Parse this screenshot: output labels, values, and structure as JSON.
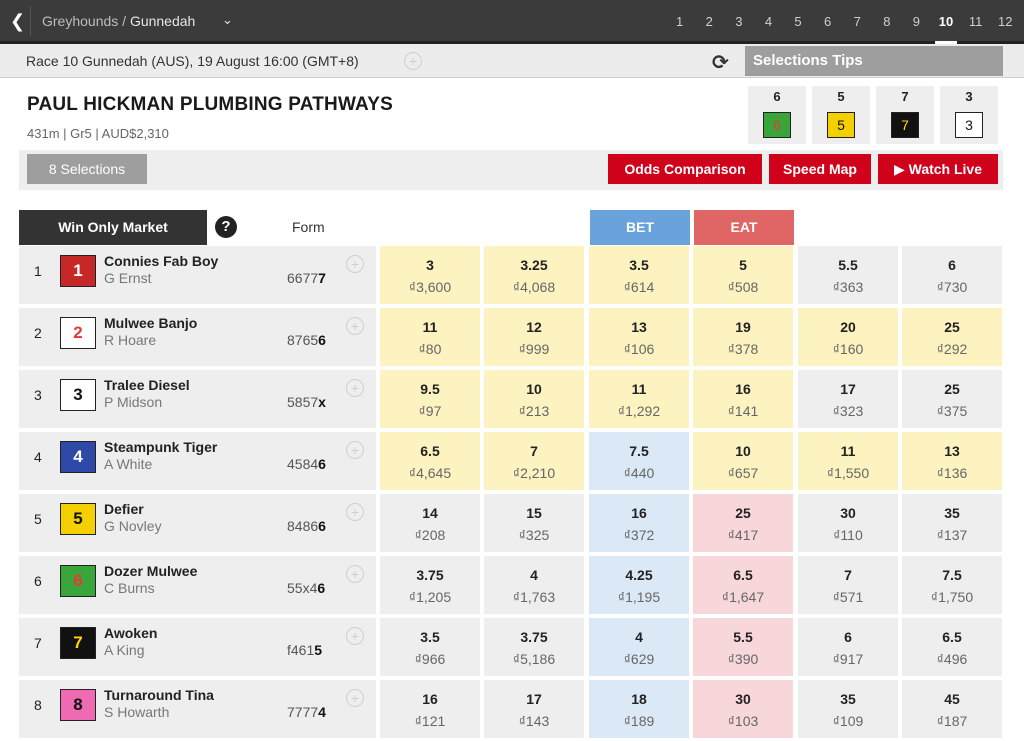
{
  "nav": {
    "back_icon": "chevron-left-icon",
    "breadcrumb_parent": "Greyhounds / ",
    "breadcrumb_current": "Gunnedah",
    "dropdown_icon": "chevron-down-icon",
    "races": [
      "1",
      "2",
      "3",
      "4",
      "5",
      "6",
      "7",
      "8",
      "9",
      "10",
      "11",
      "12"
    ],
    "active_race": "10"
  },
  "info": {
    "race_text": "Race 10 Gunnedah (AUS), 19 August 16:00 (GMT+8)",
    "plus_symbol": "+",
    "refresh_icon": "refresh-icon",
    "refresh_glyph": "⟳",
    "tips_label": "Selections Tips"
  },
  "race": {
    "title": "PAUL HICKMAN PLUMBING PATHWAYS",
    "subtitle": "431m | Gr5 | AUD$2,310"
  },
  "tips": [
    {
      "label": "6",
      "box": "6",
      "bg": "#3aa53a",
      "fg": "#e53935"
    },
    {
      "label": "5",
      "box": "5",
      "bg": "#f5d000",
      "fg": "#111111"
    },
    {
      "label": "7",
      "box": "7",
      "bg": "#111111",
      "fg": "#ffd600"
    },
    {
      "label": "3",
      "box": "3",
      "bg": "#ffffff",
      "fg": "#111111"
    }
  ],
  "selections": {
    "count_label": "8 Selections",
    "odds_comparison": "Odds Comparison",
    "speed_map": "Speed Map",
    "watch_live": "▶ Watch Live"
  },
  "market": {
    "label": "Win Only Market",
    "help": "?",
    "form_header": "Form",
    "bet_header": "BET",
    "eat_header": "EAT",
    "colors": {
      "bet": "#6aa3dc",
      "eat": "#e06666",
      "yellow_cell": "#fcf3c0",
      "blue_cell": "#dbe8f6",
      "pink_cell": "#f8d7db",
      "grey_cell": "#eeeeee"
    }
  },
  "runners": [
    {
      "num": "1",
      "rug": "1",
      "rug_bg": "#c62828",
      "rug_fg": "#ffffff",
      "name": "Connies Fab Boy",
      "trainer": "G Ernst",
      "form": "6677",
      "form_last": "7",
      "cells": [
        {
          "o": "3",
          "a": "₫3,600",
          "t": "y"
        },
        {
          "o": "3.25",
          "a": "₫4,068",
          "t": "y"
        },
        {
          "o": "3.5",
          "a": "₫614",
          "t": "y"
        },
        {
          "o": "5",
          "a": "₫508",
          "t": "y"
        },
        {
          "o": "5.5",
          "a": "₫363",
          "t": "g"
        },
        {
          "o": "6",
          "a": "₫730",
          "t": "g"
        }
      ]
    },
    {
      "num": "2",
      "rug": "2",
      "rug_bg": "#ffffff",
      "rug_fg": "#e53935",
      "name": "Mulwee Banjo",
      "trainer": "R Hoare",
      "form": "8765",
      "form_last": "6",
      "cells": [
        {
          "o": "11",
          "a": "₫80",
          "t": "y"
        },
        {
          "o": "12",
          "a": "₫999",
          "t": "y"
        },
        {
          "o": "13",
          "a": "₫106",
          "t": "y"
        },
        {
          "o": "19",
          "a": "₫378",
          "t": "y"
        },
        {
          "o": "20",
          "a": "₫160",
          "t": "y"
        },
        {
          "o": "25",
          "a": "₫292",
          "t": "y"
        }
      ]
    },
    {
      "num": "3",
      "rug": "3",
      "rug_bg": "#ffffff",
      "rug_fg": "#111111",
      "name": "Tralee Diesel",
      "trainer": "P Midson",
      "form": "5857",
      "form_last": "x",
      "cells": [
        {
          "o": "9.5",
          "a": "₫97",
          "t": "y"
        },
        {
          "o": "10",
          "a": "₫213",
          "t": "y"
        },
        {
          "o": "11",
          "a": "₫1,292",
          "t": "y"
        },
        {
          "o": "16",
          "a": "₫141",
          "t": "y"
        },
        {
          "o": "17",
          "a": "₫323",
          "t": "g"
        },
        {
          "o": "25",
          "a": "₫375",
          "t": "g"
        }
      ]
    },
    {
      "num": "4",
      "rug": "4",
      "rug_bg": "#2f49a8",
      "rug_fg": "#ffffff",
      "name": "Steampunk Tiger",
      "trainer": "A White",
      "form": "4584",
      "form_last": "6",
      "cells": [
        {
          "o": "6.5",
          "a": "₫4,645",
          "t": "y"
        },
        {
          "o": "7",
          "a": "₫2,210",
          "t": "y"
        },
        {
          "o": "7.5",
          "a": "₫440",
          "t": "b"
        },
        {
          "o": "10",
          "a": "₫657",
          "t": "y"
        },
        {
          "o": "11",
          "a": "₫1,550",
          "t": "y"
        },
        {
          "o": "13",
          "a": "₫136",
          "t": "y"
        }
      ]
    },
    {
      "num": "5",
      "rug": "5",
      "rug_bg": "#f5d000",
      "rug_fg": "#111111",
      "name": "Defier",
      "trainer": "G Novley",
      "form": "8486",
      "form_last": "6",
      "cells": [
        {
          "o": "14",
          "a": "₫208",
          "t": "g"
        },
        {
          "o": "15",
          "a": "₫325",
          "t": "g"
        },
        {
          "o": "16",
          "a": "₫372",
          "t": "b"
        },
        {
          "o": "25",
          "a": "₫417",
          "t": "p"
        },
        {
          "o": "30",
          "a": "₫110",
          "t": "g"
        },
        {
          "o": "35",
          "a": "₫137",
          "t": "g"
        }
      ]
    },
    {
      "num": "6",
      "rug": "6",
      "rug_bg": "#3aa53a",
      "rug_fg": "#e53935",
      "name": "Dozer Mulwee",
      "trainer": "C Burns",
      "form": "55x4",
      "form_last": "6",
      "cells": [
        {
          "o": "3.75",
          "a": "₫1,205",
          "t": "g"
        },
        {
          "o": "4",
          "a": "₫1,763",
          "t": "g"
        },
        {
          "o": "4.25",
          "a": "₫1,195",
          "t": "b"
        },
        {
          "o": "6.5",
          "a": "₫1,647",
          "t": "p"
        },
        {
          "o": "7",
          "a": "₫571",
          "t": "g"
        },
        {
          "o": "7.5",
          "a": "₫1,750",
          "t": "g"
        }
      ]
    },
    {
      "num": "7",
      "rug": "7",
      "rug_bg": "#111111",
      "rug_fg": "#ffd600",
      "name": "Awoken",
      "trainer": "A King",
      "form": "f461",
      "form_last": "5",
      "cells": [
        {
          "o": "3.5",
          "a": "₫966",
          "t": "g"
        },
        {
          "o": "3.75",
          "a": "₫5,186",
          "t": "g"
        },
        {
          "o": "4",
          "a": "₫629",
          "t": "b"
        },
        {
          "o": "5.5",
          "a": "₫390",
          "t": "p"
        },
        {
          "o": "6",
          "a": "₫917",
          "t": "g"
        },
        {
          "o": "6.5",
          "a": "₫496",
          "t": "g"
        }
      ]
    },
    {
      "num": "8",
      "rug": "8",
      "rug_bg": "#ee6bb3",
      "rug_fg": "#111111",
      "name": "Turnaround Tina",
      "trainer": "S Howarth",
      "form": "7777",
      "form_last": "4",
      "cells": [
        {
          "o": "16",
          "a": "₫121",
          "t": "g"
        },
        {
          "o": "17",
          "a": "₫143",
          "t": "g"
        },
        {
          "o": "18",
          "a": "₫189",
          "t": "b"
        },
        {
          "o": "30",
          "a": "₫103",
          "t": "p"
        },
        {
          "o": "35",
          "a": "₫109",
          "t": "g"
        },
        {
          "o": "45",
          "a": "₫187",
          "t": "g"
        }
      ]
    }
  ]
}
